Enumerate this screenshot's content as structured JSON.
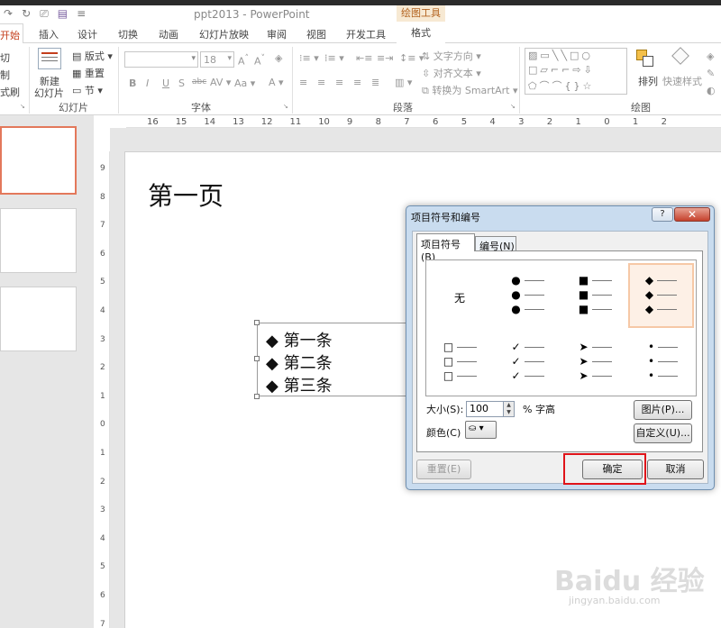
{
  "app": {
    "window_title": "ppt2013 - PowerPoint",
    "contextual_tab_group": "绘图工具"
  },
  "tabs": [
    {
      "label": "开始",
      "active": true
    },
    {
      "label": "插入"
    },
    {
      "label": "设计"
    },
    {
      "label": "切换"
    },
    {
      "label": "动画"
    },
    {
      "label": "幻灯片放映"
    },
    {
      "label": "审阅"
    },
    {
      "label": "视图"
    },
    {
      "label": "开发工具"
    },
    {
      "label": "格式"
    }
  ],
  "ribbon": {
    "clipboard": {
      "cut": "切",
      "copy": "制",
      "format_painter": "式刷"
    },
    "slides": {
      "new_slide_1": "新建",
      "new_slide_2": "幻灯片",
      "layout": "版式",
      "reset": "重置",
      "section": "节",
      "group_label": "幻灯片"
    },
    "font": {
      "font_size": "18",
      "group_label": "字体"
    },
    "paragraph": {
      "text_direction": "文字方向",
      "align_text": "对齐文本",
      "convert_smartart": "转换为 SmartArt",
      "group_label": "段落"
    },
    "drawing": {
      "arrange": "排列",
      "quick_styles": "快速样式",
      "group_label": "绘图"
    }
  },
  "ruler": {
    "h_ticks": [
      "16",
      "15",
      "14",
      "13",
      "12",
      "11",
      "10",
      "9",
      "8",
      "7",
      "6",
      "5",
      "4",
      "3",
      "2",
      "1",
      "0",
      "1",
      "2"
    ],
    "v_ticks": [
      "9",
      "8",
      "7",
      "6",
      "5",
      "4",
      "3",
      "2",
      "1",
      "0",
      "1",
      "2",
      "3",
      "4",
      "5",
      "6",
      "7"
    ]
  },
  "slide": {
    "title": "第一页",
    "bullets": [
      "第一条",
      "第二条",
      "第三条"
    ],
    "bullet_glyph": "◆"
  },
  "dialog": {
    "title": "项目符号和编号",
    "help_glyph": "?",
    "close_glyph": "✕",
    "tabs": [
      "项目符号(B)",
      "编号(N)"
    ],
    "gallery_none_label": "无",
    "gallery": [
      {
        "glyph": "",
        "label": "无"
      },
      {
        "glyph": "●",
        "icon": "filled-circle-bullets"
      },
      {
        "glyph": "■",
        "icon": "filled-square-bullets"
      },
      {
        "glyph": "◆",
        "icon": "diamond-bullets",
        "selected": true
      },
      {
        "glyph": "□",
        "icon": "hollow-square-bullets"
      },
      {
        "glyph": "✓",
        "icon": "checkmark-bullets"
      },
      {
        "glyph": "➤",
        "icon": "arrowhead-bullets"
      },
      {
        "glyph": "•",
        "icon": "small-dot-bullets"
      }
    ],
    "size_label": "大小(S):",
    "size_value": "100",
    "size_unit": "% 字高",
    "color_label": "颜色(C)",
    "picture_button": "图片(P)...",
    "customize_button": "自定义(U)...",
    "reset_button": "重置(E)",
    "ok_button": "确定",
    "cancel_button": "取消"
  },
  "watermark": {
    "logo": "Baidu 经验",
    "url": "jingyan.baidu.com"
  },
  "colors": {
    "accent_home_tab": "#c43e1c",
    "selection_highlight": "#e0141a",
    "dialog_frame": "#c9dcef"
  }
}
